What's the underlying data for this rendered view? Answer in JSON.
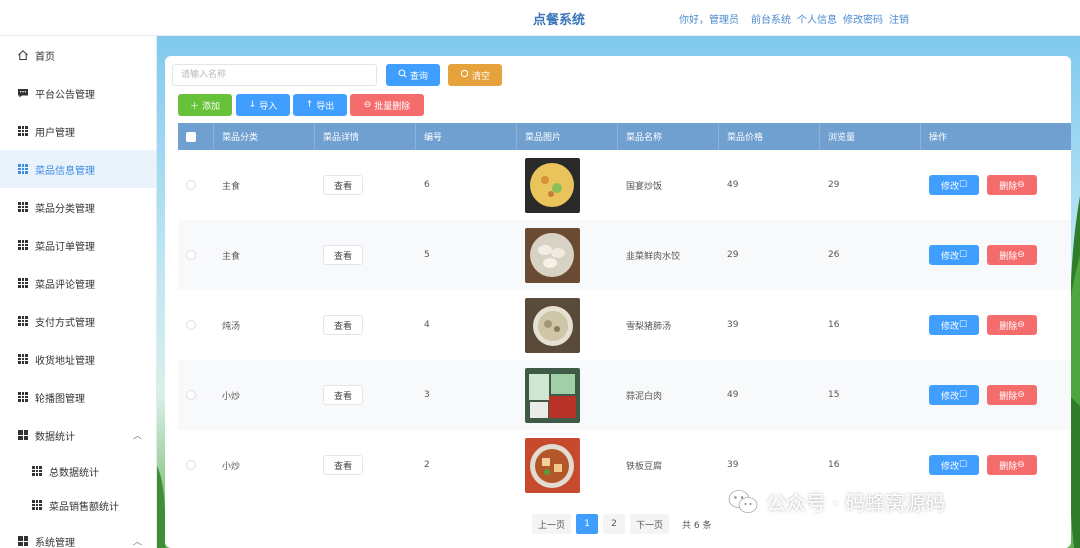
{
  "header": {
    "title": "点餐系统",
    "greeting": "你好，管理员",
    "links": [
      "前台系统",
      "个人信息",
      "修改密码",
      "注销"
    ]
  },
  "sidebar": {
    "items": [
      {
        "label": "首页",
        "icon": "home-icon"
      },
      {
        "label": "平台公告管理",
        "icon": "message-icon"
      },
      {
        "label": "用户管理",
        "icon": "grid-icon"
      },
      {
        "label": "菜品信息管理",
        "icon": "grid-icon",
        "active": true
      },
      {
        "label": "菜品分类管理",
        "icon": "grid-icon"
      },
      {
        "label": "菜品订单管理",
        "icon": "grid-icon"
      },
      {
        "label": "菜品评论管理",
        "icon": "grid-icon"
      },
      {
        "label": "支付方式管理",
        "icon": "grid-icon"
      },
      {
        "label": "收货地址管理",
        "icon": "grid-icon"
      },
      {
        "label": "轮播图管理",
        "icon": "grid-icon"
      },
      {
        "label": "数据统计",
        "icon": "grid2-icon",
        "expanded": true
      },
      {
        "label": "总数据统计",
        "icon": "grid-icon",
        "sub": true
      },
      {
        "label": "菜品销售额统计",
        "icon": "grid-icon",
        "sub": true
      },
      {
        "label": "系统管理",
        "icon": "grid2-icon",
        "expanded": true
      }
    ]
  },
  "search": {
    "placeholder": "请输入名称",
    "query_label": "查询",
    "clear_label": "清空"
  },
  "toolbar": {
    "add_label": "添加",
    "import_label": "导入",
    "export_label": "导出",
    "batch_delete_label": "批量删除"
  },
  "table": {
    "columns": [
      "菜品分类",
      "菜品详情",
      "编号",
      "菜品图片",
      "菜品名称",
      "菜品价格",
      "浏览量",
      "操作"
    ],
    "view_label": "查看",
    "edit_label": "修改",
    "delete_label": "删除",
    "rows": [
      {
        "category": "主食",
        "id": "6",
        "name": "国宴炒饭",
        "price": "49",
        "views": "29"
      },
      {
        "category": "主食",
        "id": "5",
        "name": "韭菜鲜肉水饺",
        "price": "29",
        "views": "26"
      },
      {
        "category": "炖汤",
        "id": "4",
        "name": "雪梨猪肺汤",
        "price": "39",
        "views": "16"
      },
      {
        "category": "小炒",
        "id": "3",
        "name": "蒜泥白肉",
        "price": "49",
        "views": "15"
      },
      {
        "category": "小炒",
        "id": "2",
        "name": "铁板豆腐",
        "price": "39",
        "views": "16"
      }
    ]
  },
  "pagination": {
    "prev_label": "上一页",
    "pages": [
      "1",
      "2"
    ],
    "current": "1",
    "next_label": "下一页",
    "total_label": "共 6 条"
  },
  "watermark": {
    "text": "公众号 · 码蜂窝源码"
  },
  "colors": {
    "primary": "#409eff",
    "success": "#67c23a",
    "warning": "#e6a23c",
    "danger": "#f56c6c",
    "table_header": "#6fa0d0"
  }
}
